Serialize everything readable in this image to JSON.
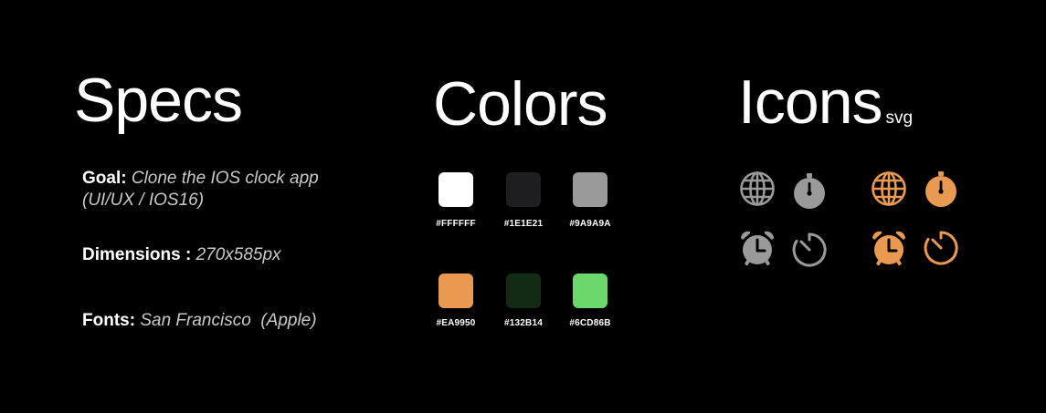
{
  "specs": {
    "title": "Specs",
    "goal_label": "Goal:",
    "goal_value_line1": "Clone the IOS clock app",
    "goal_value_line2": "(UI/UX / IOS16)",
    "dimensions_label": "Dimensions :",
    "dimensions_value": "270x585px",
    "fonts_label": "Fonts:",
    "fonts_value": "San Francisco  (Apple)"
  },
  "colors": {
    "title": "Colors",
    "swatches": [
      {
        "hex": "#FFFFFF",
        "label": "#FFFFFF"
      },
      {
        "hex": "#1E1E21",
        "label": "#1E1E21"
      },
      {
        "hex": "#9A9A9A",
        "label": "#9A9A9A"
      },
      {
        "hex": "#EA9950",
        "label": "#EA9950"
      },
      {
        "hex": "#132B14",
        "label": "#132B14"
      },
      {
        "hex": "#6CD86B",
        "label": "#6CD86B"
      }
    ]
  },
  "icons": {
    "title": "Icons",
    "subtitle": "svg",
    "gray_color": "#9A9A9A",
    "orange_color": "#EA9950",
    "set": [
      "globe-icon",
      "stopwatch-icon",
      "alarm-icon",
      "timer-icon"
    ]
  }
}
